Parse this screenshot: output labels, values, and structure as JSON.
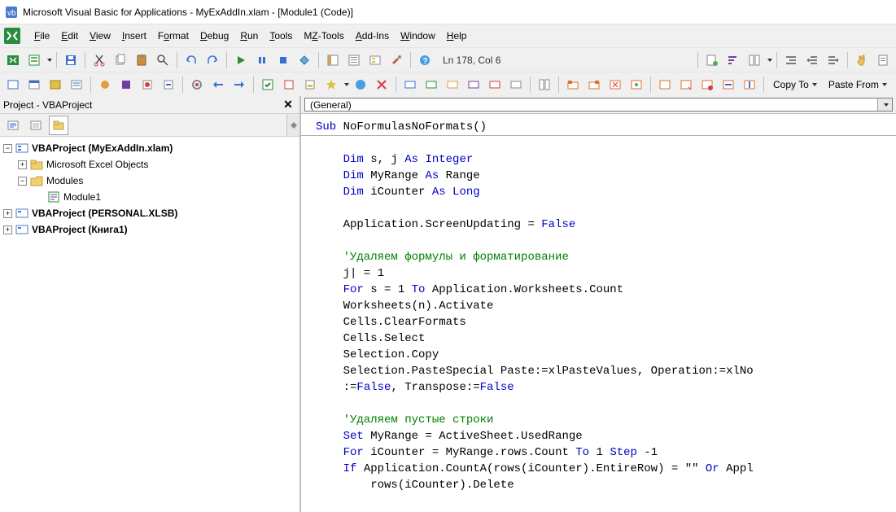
{
  "title": "Microsoft Visual Basic for Applications - MyExAddIn.xlam - [Module1 (Code)]",
  "menu": [
    "File",
    "Edit",
    "View",
    "Insert",
    "Format",
    "Debug",
    "Run",
    "Tools",
    "MZ-Tools",
    "Add-Ins",
    "Window",
    "Help"
  ],
  "status_pos": "Ln 178, Col 6",
  "copy_to": "Copy To",
  "paste_from": "Paste From",
  "project_pane_title": "Project - VBAProject",
  "tree": {
    "p1": "VBAProject (MyExAddIn.xlam)",
    "p1a": "Microsoft Excel Objects",
    "p1b": "Modules",
    "p1b1": "Module1",
    "p2": "VBAProject (PERSONAL.XLSB)",
    "p3": "VBAProject (Книга1)"
  },
  "code_dropdown": "(General)",
  "code": {
    "l1a": "Sub",
    "l1b": " NoFormulasNoFormats()",
    "l3a": "    ",
    "l3b": "Dim",
    "l3c": " s, j ",
    "l3d": "As Integer",
    "l4a": "    ",
    "l4b": "Dim",
    "l4c": " MyRange ",
    "l4d": "As",
    "l4e": " Range",
    "l5a": "    ",
    "l5b": "Dim",
    "l5c": " iCounter ",
    "l5d": "As Long",
    "l7": "    Application.ScreenUpdating = ",
    "l7b": "False",
    "l9": "    'Удаляем формулы и форматирование",
    "l10": "    j| = 1",
    "l11a": "    ",
    "l11b": "For",
    "l11c": " s = 1 ",
    "l11d": "To",
    "l11e": " Application.Worksheets.Count",
    "l12": "    Worksheets(n).Activate",
    "l13": "    Cells.ClearFormats",
    "l14": "    Cells.Select",
    "l15": "    Selection.Copy",
    "l16": "    Selection.PasteSpecial Paste:=xlPasteValues, Operation:=xlNo",
    "l17a": "    :=",
    "l17b": "False",
    "l17c": ", Transpose:=",
    "l17d": "False",
    "l19": "    'Удаляем пустые строки",
    "l20a": "    ",
    "l20b": "Set",
    "l20c": " MyRange = ActiveSheet.UsedRange",
    "l21a": "    ",
    "l21b": "For",
    "l21c": " iCounter = MyRange.rows.Count ",
    "l21d": "To",
    "l21e": " 1 ",
    "l21f": "Step",
    "l21g": " -1",
    "l22a": "    ",
    "l22b": "If",
    "l22c": " Application.CountA(rows(iCounter).EntireRow) = \"\" ",
    "l22d": "Or",
    "l22e": " Appl",
    "l23": "        rows(iCounter).Delete"
  }
}
